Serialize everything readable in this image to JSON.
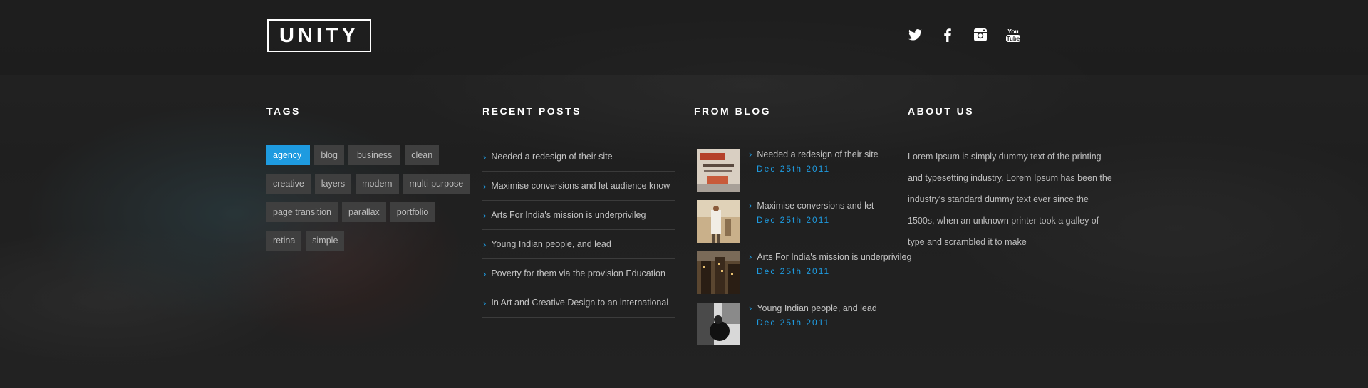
{
  "header": {
    "logo": "UNITY",
    "social": [
      "twitter-icon",
      "facebook-icon",
      "instagram-icon",
      "youtube-icon"
    ]
  },
  "tags": {
    "title": "TAGS",
    "items": [
      {
        "label": "agency",
        "active": true
      },
      {
        "label": "blog"
      },
      {
        "label": "business"
      },
      {
        "label": "clean"
      },
      {
        "label": "creative"
      },
      {
        "label": "layers"
      },
      {
        "label": "modern"
      },
      {
        "label": "multi-purpose"
      },
      {
        "label": "page transition"
      },
      {
        "label": "parallax"
      },
      {
        "label": "portfolio"
      },
      {
        "label": "retina"
      },
      {
        "label": "simple"
      }
    ]
  },
  "recent_posts": {
    "title": "RECENT POSTS",
    "items": [
      "Needed a redesign of their site",
      "Maximise conversions and let audience know",
      "Arts For India's mission is  underprivileg",
      "Young Indian people, and lead",
      "Poverty for them via the provision Education",
      "In Art and Creative Design to an international"
    ]
  },
  "from_blog": {
    "title": "FROM BLOG",
    "items": [
      {
        "title": "Needed a redesign of their site",
        "date": "Dec 25th 2011"
      },
      {
        "title": "Maximise conversions and let",
        "date": "Dec 25th 2011"
      },
      {
        "title": "Arts For India's mission is  underprivileg",
        "date": "Dec 25th 2011"
      },
      {
        "title": "Young Indian people, and lead",
        "date": "Dec 25th 2011"
      }
    ]
  },
  "about": {
    "title": "ABOUT US",
    "text": "Lorem Ipsum is simply dummy text of the printing and typesetting industry. Lorem Ipsum has been the industry's standard dummy text ever since the 1500s, when an unknown printer took a galley of type and scrambled it to make"
  },
  "colors": {
    "accent": "#1e9be0",
    "tag_bg": "#3f3f3f"
  }
}
